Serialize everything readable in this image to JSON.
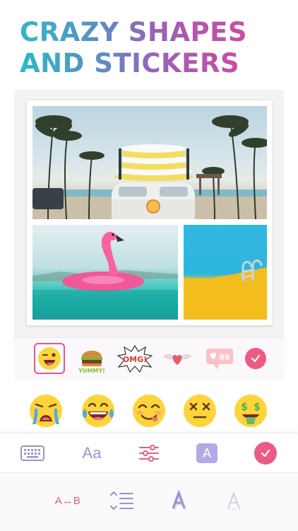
{
  "headline": {
    "line1": "CRAZY SHAPES",
    "line2": "AND STICKERS"
  },
  "collage": {
    "photos": [
      "beach-van-photo",
      "flamingo-float-photo",
      "pool-ladder-photo"
    ]
  },
  "stickers": {
    "items": [
      "winking-emoji",
      "yummy-burger",
      "omg",
      "winged-heart",
      "likes-badge"
    ],
    "likes_count": "99",
    "yummy_text": "YUMMY!",
    "omg_text": "OMG!"
  },
  "emoji_row": [
    "crying-face",
    "laughing-tears-face",
    "yummy-face",
    "dizzy-face",
    "money-mouth-face"
  ],
  "toolbar": {
    "font_label": "Aa",
    "color_label": "A"
  },
  "text_tools": {
    "swap_label": "A↔B"
  },
  "colors": {
    "accent": "#ec5b84",
    "icon_purple": "#9b93cf",
    "color_tile": "#b3a9e6"
  }
}
